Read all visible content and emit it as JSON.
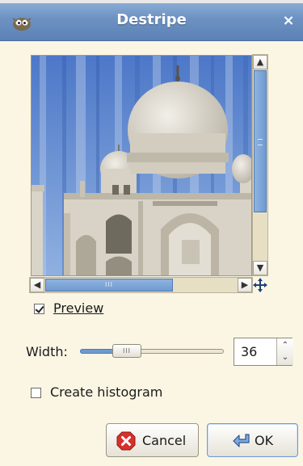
{
  "window": {
    "title": "Destripe",
    "close_label": "×"
  },
  "preview": {
    "horizontal_thumb_grip": "III"
  },
  "preview_toggle": {
    "label": "Preview",
    "checked": true
  },
  "width": {
    "label": "Width:",
    "value": "36",
    "slider_grip": "III",
    "slider_level": 0.28
  },
  "histogram_toggle": {
    "label": "Create histogram",
    "checked": false
  },
  "buttons": {
    "cancel": "Cancel",
    "ok": "OK"
  },
  "colors": {
    "titlebar": "#6d92c2",
    "background": "#fbf6e4",
    "accent": "#6f9ad0"
  },
  "icons": [
    "gimp-icon",
    "close-icon",
    "scroll-up-icon",
    "scroll-down-icon",
    "scroll-left-icon",
    "scroll-right-icon",
    "navigate-icon",
    "spin-up-icon",
    "spin-down-icon",
    "cancel-icon",
    "ok-icon"
  ]
}
